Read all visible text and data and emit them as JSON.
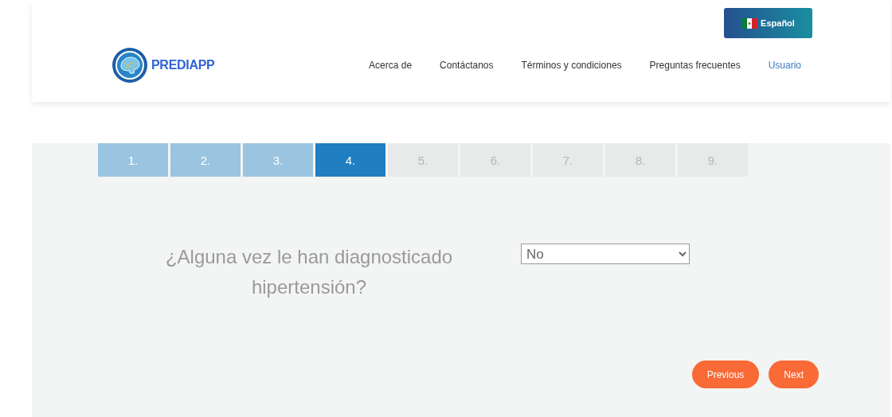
{
  "language_button": {
    "label": "Español"
  },
  "logo": {
    "text": "PREDIAPP"
  },
  "nav": [
    {
      "label": "Acerca de",
      "selected": false
    },
    {
      "label": "Contáctanos",
      "selected": false
    },
    {
      "label": "Términos y condiciones",
      "selected": false
    },
    {
      "label": "Preguntas frecuentes",
      "selected": false
    },
    {
      "label": "Usuario",
      "selected": true
    }
  ],
  "steps": [
    {
      "label": "1.",
      "selected": false,
      "completed": true
    },
    {
      "label": "2.",
      "selected": false,
      "completed": true
    },
    {
      "label": "3.",
      "selected": false,
      "completed": true
    },
    {
      "label": "4.",
      "selected": true,
      "completed": false
    },
    {
      "label": "5.",
      "selected": false,
      "completed": false
    },
    {
      "label": "6.",
      "selected": false,
      "completed": false
    },
    {
      "label": "7.",
      "selected": false,
      "completed": false
    },
    {
      "label": "8.",
      "selected": false,
      "completed": false
    },
    {
      "label": "9.",
      "selected": false,
      "completed": false
    }
  ],
  "question": {
    "text": "¿Alguna vez le han diagnosticado hipertensión?",
    "answer": "No"
  },
  "buttons": [
    {
      "label": "Previous"
    },
    {
      "label": "Next"
    }
  ]
}
